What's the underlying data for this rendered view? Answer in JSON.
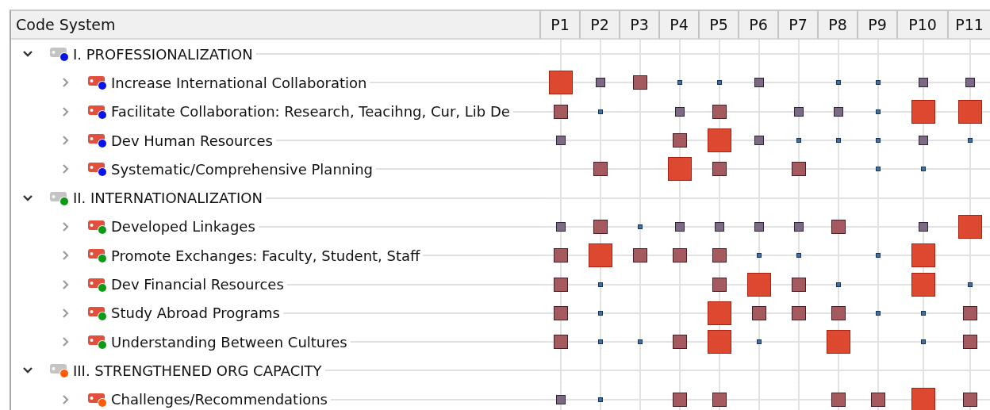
{
  "header": {
    "title": "Code System",
    "columns": [
      "P1",
      "P2",
      "P3",
      "P4",
      "P5",
      "P6",
      "P7",
      "P8",
      "P9",
      "P10",
      "P11"
    ]
  },
  "groups": [
    {
      "label": "I. PROFESSIONALIZATION",
      "color": "#0a14e6",
      "expanded": true,
      "children": [
        {
          "label": "Increase International Collaboration",
          "expanded": false,
          "cells": [
            {
              "kind": "large"
            },
            {
              "kind": "small"
            },
            {
              "kind": "medium"
            },
            {
              "kind": "tiny"
            },
            {
              "kind": "tiny"
            },
            {
              "kind": "small"
            },
            {
              "kind": "empty"
            },
            {
              "kind": "tiny"
            },
            {
              "kind": "tiny"
            },
            {
              "kind": "small"
            },
            {
              "kind": "small"
            }
          ]
        },
        {
          "label": "Facilitate Collaboration: Research, Teacihng, Cur, Lib De",
          "expanded": false,
          "cells": [
            {
              "kind": "medium"
            },
            {
              "kind": "tiny"
            },
            {
              "kind": "empty"
            },
            {
              "kind": "small"
            },
            {
              "kind": "medium"
            },
            {
              "kind": "empty"
            },
            {
              "kind": "small"
            },
            {
              "kind": "small"
            },
            {
              "kind": "tiny"
            },
            {
              "kind": "large"
            },
            {
              "kind": "large"
            }
          ]
        },
        {
          "label": "Dev Human Resources",
          "expanded": false,
          "cells": [
            {
              "kind": "small"
            },
            {
              "kind": "empty"
            },
            {
              "kind": "empty"
            },
            {
              "kind": "medium"
            },
            {
              "kind": "large"
            },
            {
              "kind": "small"
            },
            {
              "kind": "tiny"
            },
            {
              "kind": "tiny"
            },
            {
              "kind": "tiny"
            },
            {
              "kind": "small"
            },
            {
              "kind": "tiny"
            }
          ]
        },
        {
          "label": "Systematic/Comprehensive Planning",
          "expanded": false,
          "cells": [
            {
              "kind": "empty"
            },
            {
              "kind": "medium"
            },
            {
              "kind": "empty"
            },
            {
              "kind": "large"
            },
            {
              "kind": "medium"
            },
            {
              "kind": "empty"
            },
            {
              "kind": "medium"
            },
            {
              "kind": "empty"
            },
            {
              "kind": "tiny"
            },
            {
              "kind": "tiny"
            },
            {
              "kind": "empty"
            }
          ]
        }
      ]
    },
    {
      "label": "II. INTERNATIONALIZATION",
      "color": "#0a9a14",
      "expanded": true,
      "children": [
        {
          "label": "Developed Linkages",
          "expanded": false,
          "cells": [
            {
              "kind": "small"
            },
            {
              "kind": "medium"
            },
            {
              "kind": "tiny"
            },
            {
              "kind": "small"
            },
            {
              "kind": "small"
            },
            {
              "kind": "small"
            },
            {
              "kind": "small"
            },
            {
              "kind": "medium"
            },
            {
              "kind": "empty"
            },
            {
              "kind": "small"
            },
            {
              "kind": "large"
            }
          ]
        },
        {
          "label": "Promote Exchanges: Faculty, Student, Staff",
          "expanded": false,
          "cells": [
            {
              "kind": "medium"
            },
            {
              "kind": "large"
            },
            {
              "kind": "medium"
            },
            {
              "kind": "medium"
            },
            {
              "kind": "medium"
            },
            {
              "kind": "tiny"
            },
            {
              "kind": "tiny"
            },
            {
              "kind": "empty"
            },
            {
              "kind": "tiny"
            },
            {
              "kind": "large"
            },
            {
              "kind": "empty"
            }
          ]
        },
        {
          "label": "Dev Financial Resources",
          "expanded": false,
          "cells": [
            {
              "kind": "medium"
            },
            {
              "kind": "tiny"
            },
            {
              "kind": "empty"
            },
            {
              "kind": "empty"
            },
            {
              "kind": "medium"
            },
            {
              "kind": "large"
            },
            {
              "kind": "medium"
            },
            {
              "kind": "tiny"
            },
            {
              "kind": "empty"
            },
            {
              "kind": "large"
            },
            {
              "kind": "tiny"
            }
          ]
        },
        {
          "label": "Study Abroad Programs",
          "expanded": false,
          "cells": [
            {
              "kind": "medium"
            },
            {
              "kind": "tiny"
            },
            {
              "kind": "empty"
            },
            {
              "kind": "empty"
            },
            {
              "kind": "large"
            },
            {
              "kind": "medium"
            },
            {
              "kind": "medium"
            },
            {
              "kind": "medium"
            },
            {
              "kind": "tiny"
            },
            {
              "kind": "tiny"
            },
            {
              "kind": "medium"
            }
          ]
        },
        {
          "label": "Understanding Between Cultures",
          "expanded": false,
          "cells": [
            {
              "kind": "medium"
            },
            {
              "kind": "tiny"
            },
            {
              "kind": "tiny"
            },
            {
              "kind": "medium"
            },
            {
              "kind": "large"
            },
            {
              "kind": "tiny"
            },
            {
              "kind": "empty"
            },
            {
              "kind": "large"
            },
            {
              "kind": "empty"
            },
            {
              "kind": "tiny"
            },
            {
              "kind": "medium"
            }
          ]
        }
      ]
    },
    {
      "label": "III. STRENGTHENED ORG CAPACITY",
      "color": "#ff5a0a",
      "expanded": true,
      "children": [
        {
          "label": "Challenges/Recommendations",
          "expanded": false,
          "cells": [
            {
              "kind": "small"
            },
            {
              "kind": "tiny"
            },
            {
              "kind": "empty"
            },
            {
              "kind": "medium"
            },
            {
              "kind": "medium"
            },
            {
              "kind": "empty"
            },
            {
              "kind": "empty"
            },
            {
              "kind": "medium"
            },
            {
              "kind": "medium"
            },
            {
              "kind": "large"
            },
            {
              "kind": "medium"
            }
          ]
        }
      ]
    }
  ]
}
